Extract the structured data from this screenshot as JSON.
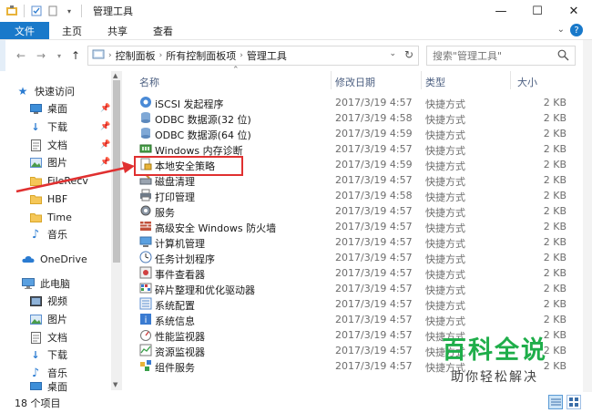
{
  "window": {
    "title": "管理工具",
    "minimize": "—",
    "maximize": "☐",
    "close": "✕"
  },
  "ribbon": {
    "tabs": [
      "文件",
      "主页",
      "共享",
      "查看"
    ],
    "help": "?"
  },
  "address": {
    "crumbs": [
      "控制面板",
      "所有控制面板项",
      "管理工具"
    ],
    "search_placeholder": "搜索\"管理工具\""
  },
  "nav": {
    "quick_access": "快速访问",
    "items": [
      {
        "label": "桌面",
        "icon": "desktop-icon",
        "pinned": true
      },
      {
        "label": "下载",
        "icon": "download-icon",
        "pinned": true
      },
      {
        "label": "文档",
        "icon": "document-icon",
        "pinned": true
      },
      {
        "label": "图片",
        "icon": "picture-icon",
        "pinned": true
      },
      {
        "label": "FileRecv",
        "icon": "folder-icon"
      },
      {
        "label": "HBF",
        "icon": "folder-icon"
      },
      {
        "label": "Time",
        "icon": "folder-icon"
      },
      {
        "label": "音乐",
        "icon": "music-icon"
      }
    ],
    "onedrive": "OneDrive",
    "this_pc": "此电脑",
    "pc_items": [
      {
        "label": "视频",
        "icon": "video-icon"
      },
      {
        "label": "图片",
        "icon": "picture-icon"
      },
      {
        "label": "文档",
        "icon": "document-icon"
      },
      {
        "label": "下载",
        "icon": "download-icon"
      },
      {
        "label": "音乐",
        "icon": "music-icon"
      },
      {
        "label": "桌面",
        "icon": "desktop-icon"
      }
    ]
  },
  "columns": {
    "name": "名称",
    "date": "修改日期",
    "type": "类型",
    "size": "大小"
  },
  "files": [
    {
      "name": "iSCSI 发起程序",
      "date": "2017/3/19 4:57",
      "type": "快捷方式",
      "size": "2 KB"
    },
    {
      "name": "ODBC 数据源(32 位)",
      "date": "2017/3/19 4:58",
      "type": "快捷方式",
      "size": "2 KB"
    },
    {
      "name": "ODBC 数据源(64 位)",
      "date": "2017/3/19 4:59",
      "type": "快捷方式",
      "size": "2 KB"
    },
    {
      "name": "Windows 内存诊断",
      "date": "2017/3/19 4:57",
      "type": "快捷方式",
      "size": "2 KB"
    },
    {
      "name": "本地安全策略",
      "date": "2017/3/19 4:59",
      "type": "快捷方式",
      "size": "2 KB"
    },
    {
      "name": "磁盘清理",
      "date": "2017/3/19 4:57",
      "type": "快捷方式",
      "size": "2 KB"
    },
    {
      "name": "打印管理",
      "date": "2017/3/19 4:58",
      "type": "快捷方式",
      "size": "2 KB"
    },
    {
      "name": "服务",
      "date": "2017/3/19 4:57",
      "type": "快捷方式",
      "size": "2 KB"
    },
    {
      "name": "高级安全 Windows 防火墙",
      "date": "2017/3/19 4:57",
      "type": "快捷方式",
      "size": "2 KB"
    },
    {
      "name": "计算机管理",
      "date": "2017/3/19 4:57",
      "type": "快捷方式",
      "size": "2 KB"
    },
    {
      "name": "任务计划程序",
      "date": "2017/3/19 4:57",
      "type": "快捷方式",
      "size": "2 KB"
    },
    {
      "name": "事件查看器",
      "date": "2017/3/19 4:57",
      "type": "快捷方式",
      "size": "2 KB"
    },
    {
      "name": "碎片整理和优化驱动器",
      "date": "2017/3/19 4:57",
      "type": "快捷方式",
      "size": "2 KB"
    },
    {
      "name": "系统配置",
      "date": "2017/3/19 4:57",
      "type": "快捷方式",
      "size": "2 KB"
    },
    {
      "name": "系统信息",
      "date": "2017/3/19 4:57",
      "type": "快捷方式",
      "size": "2 KB"
    },
    {
      "name": "性能监视器",
      "date": "2017/3/19 4:57",
      "type": "快捷方式",
      "size": "2 KB"
    },
    {
      "name": "资源监视器",
      "date": "2017/3/19 4:57",
      "type": "快捷方式",
      "size": "2 KB"
    },
    {
      "name": "组件服务",
      "date": "2017/3/19 4:57",
      "type": "快捷方式",
      "size": "2 KB"
    }
  ],
  "status": {
    "count": "18 个项目"
  },
  "watermark": {
    "title": "百科全说",
    "subtitle": "助你轻松解决"
  },
  "colors": {
    "accent": "#1979ca",
    "highlight": "#e03030",
    "watermark": "#1fae4a"
  }
}
